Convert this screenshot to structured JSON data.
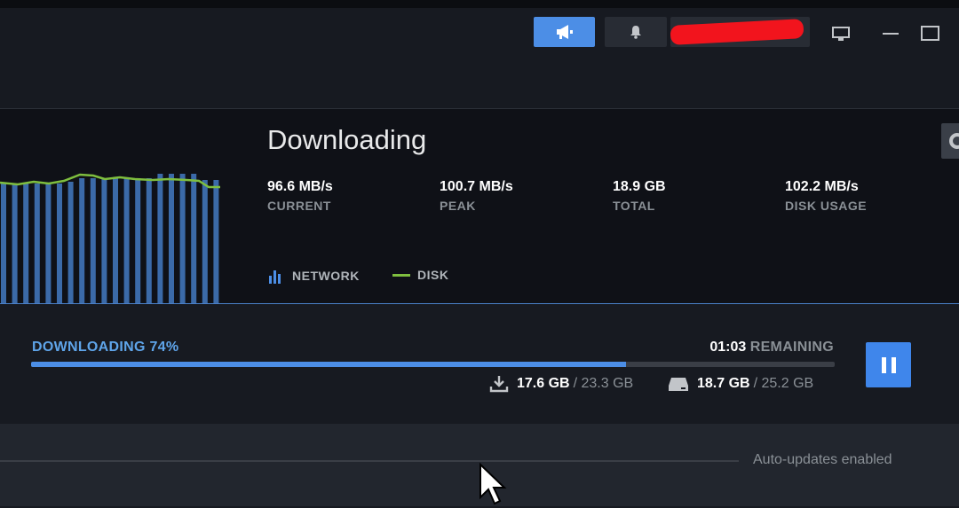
{
  "titlebar": {
    "announce_icon": "megaphone-icon",
    "notif_icon": "bell-icon",
    "account_name_redacted": true,
    "controls": [
      "big-picture-icon",
      "minimize-icon",
      "maximize-icon"
    ]
  },
  "downloads": {
    "title": "Downloading",
    "stats": [
      {
        "value": "96.6 MB/s",
        "label": "CURRENT"
      },
      {
        "value": "100.7 MB/s",
        "label": "PEAK"
      },
      {
        "value": "18.9 GB",
        "label": "TOTAL"
      },
      {
        "value": "102.2 MB/s",
        "label": "DISK USAGE"
      }
    ],
    "legend": {
      "network": "NETWORK",
      "disk": "DISK"
    },
    "progress": {
      "status": "DOWNLOADING 74%",
      "fraction": 0.74,
      "remaining_time": "01:03",
      "remaining_label": "REMAINING",
      "download_current": "17.6 GB",
      "download_total": "/ 23.3 GB",
      "disk_current": "18.7 GB",
      "disk_total": "/ 25.2 GB"
    },
    "footer": {
      "auto_updates": "Auto-updates enabled"
    }
  },
  "colors": {
    "accent": "#4c8ee6",
    "network_bars": "#3b6aa8",
    "disk_line": "#7fbf3f"
  }
}
